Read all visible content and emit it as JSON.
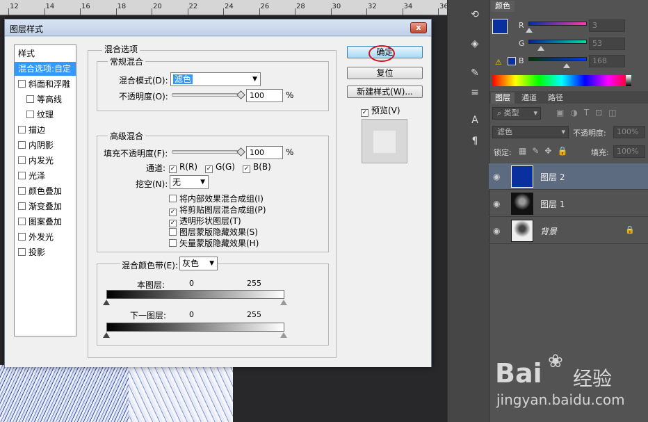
{
  "ruler": {
    "ticks": [
      "12",
      "14",
      "16",
      "18",
      "20",
      "22",
      "24",
      "26",
      "28",
      "30",
      "32",
      "34",
      "36"
    ]
  },
  "dialog": {
    "title": "图层样式",
    "close_label": "x",
    "styles_header": "样式",
    "style_items": [
      {
        "label": "混合选项:自定",
        "selected": true,
        "checkbox": false
      },
      {
        "label": "斜面和浮雕",
        "checkbox": true,
        "checked": false
      },
      {
        "label": "等高线",
        "checkbox": true,
        "checked": false,
        "indent": true
      },
      {
        "label": "纹理",
        "checkbox": true,
        "checked": false,
        "indent": true
      },
      {
        "label": "描边",
        "checkbox": true,
        "checked": false
      },
      {
        "label": "内阴影",
        "checkbox": true,
        "checked": false
      },
      {
        "label": "内发光",
        "checkbox": true,
        "checked": false
      },
      {
        "label": "光泽",
        "checkbox": true,
        "checked": false
      },
      {
        "label": "颜色叠加",
        "checkbox": true,
        "checked": false
      },
      {
        "label": "渐变叠加",
        "checkbox": true,
        "checked": false
      },
      {
        "label": "图案叠加",
        "checkbox": true,
        "checked": false
      },
      {
        "label": "外发光",
        "checkbox": true,
        "checked": false
      },
      {
        "label": "投影",
        "checkbox": true,
        "checked": false
      }
    ],
    "blend_options_title": "混合选项",
    "general_title": "常规混合",
    "blend_mode_label": "混合模式(D):",
    "blend_mode_value": "滤色",
    "opacity_label": "不透明度(O):",
    "opacity_value": "100",
    "percent": "%",
    "advanced_title": "高级混合",
    "fill_opacity_label": "填充不透明度(F):",
    "fill_opacity_value": "100",
    "channels_label": "通道:",
    "channels": [
      {
        "label": "R(R)",
        "checked": true
      },
      {
        "label": "G(G)",
        "checked": true
      },
      {
        "label": "B(B)",
        "checked": true
      }
    ],
    "knockout_label": "挖空(N):",
    "knockout_value": "无",
    "advanced_checks": [
      {
        "label": "将内部效果混合成组(I)",
        "checked": false
      },
      {
        "label": "将剪贴图层混合成组(P)",
        "checked": true
      },
      {
        "label": "透明形状图层(T)",
        "checked": true
      },
      {
        "label": "图层蒙版隐藏效果(S)",
        "checked": false
      },
      {
        "label": "矢量蒙版隐藏效果(H)",
        "checked": false
      }
    ],
    "blend_if_label": "混合颜色带(E):",
    "blend_if_value": "灰色",
    "this_layer_label": "本图层:",
    "this_layer_min": "0",
    "this_layer_max": "255",
    "underlying_label": "下一图层:",
    "underlying_min": "0",
    "underlying_max": "255",
    "ok_label": "确定",
    "reset_label": "复位",
    "new_style_label": "新建样式(W)...",
    "preview_label": "预览(V)",
    "preview_checked": true
  },
  "color_panel": {
    "tab": "颜色",
    "foreground": "#0a2f9e",
    "channels": [
      {
        "label": "R",
        "value": "3",
        "fraction": 0.01
      },
      {
        "label": "G",
        "value": "53",
        "fraction": 0.21
      },
      {
        "label": "B",
        "value": "168",
        "fraction": 0.66
      }
    ]
  },
  "layers_panel": {
    "tabs": [
      "图层",
      "通道",
      "路径"
    ],
    "filter_label": "类型",
    "blend_mode": "滤色",
    "opacity_label": "不透明度:",
    "opacity_value": "100%",
    "lock_label": "锁定:",
    "fill_label": "填充:",
    "fill_value": "100%",
    "layers": [
      {
        "name": "图层 2",
        "selected": true,
        "thumb_color": "#0a2f9e"
      },
      {
        "name": "图层 1",
        "selected": false,
        "thumb_color": "#222222"
      },
      {
        "name": "背景",
        "selected": false,
        "thumb_color": "#e8e8e8",
        "locked": true
      }
    ]
  },
  "watermark": {
    "brand": "Bai",
    "brand_suffix": "经验",
    "url": "jingyan.baidu.com"
  }
}
